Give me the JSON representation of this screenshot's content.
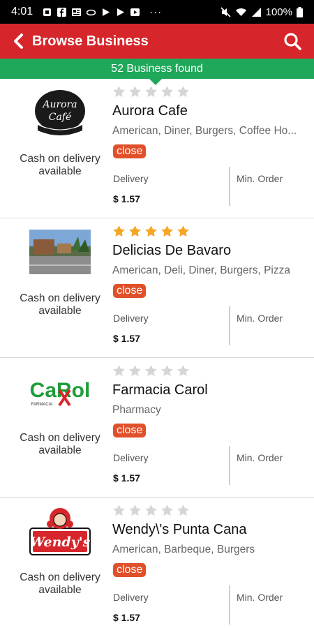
{
  "status_bar": {
    "time": "4:01",
    "more": "···",
    "battery": "100%"
  },
  "header": {
    "title": "Browse Business"
  },
  "found": {
    "text": "52 Business found"
  },
  "colors": {
    "header": "#d7262b",
    "found_bar": "#1fa85a",
    "badge": "#e0502a",
    "star_on": "#f5a623",
    "star_off": "#d6d6d6"
  },
  "logos": {
    "aurora_line1": "Aurora",
    "aurora_line2": "Café",
    "carol_logo": "CaRol",
    "carol_sub": "FARMACIA",
    "wendys_logo": "Wendy's"
  },
  "businesses": [
    {
      "name": "Aurora Cafe",
      "rating": 0,
      "cuisine": "American, Diner, Burgers, Coffee Ho...",
      "status": "close",
      "cod": "Cash on delivery available",
      "delivery_label": "Delivery",
      "delivery_value": "$ 1.57",
      "min_order_label": "Min. Order",
      "logo_icon": "aurora-cafe-logo"
    },
    {
      "name": "Delicias De Bavaro",
      "rating": 5,
      "cuisine": "American, Deli, Diner, Burgers, Pizza",
      "status": "close",
      "cod": "Cash on delivery available",
      "delivery_label": "Delivery",
      "delivery_value": "$ 1.57",
      "min_order_label": "Min. Order",
      "logo_icon": "street-photo"
    },
    {
      "name": "Farmacia Carol",
      "rating": 0,
      "cuisine": "Pharmacy",
      "status": "close",
      "cod": "Cash on delivery available",
      "delivery_label": "Delivery",
      "delivery_value": "$ 1.57",
      "min_order_label": "Min. Order",
      "logo_icon": "farmacia-carol-logo"
    },
    {
      "name": "Wendy\\'s Punta Cana",
      "rating": 0,
      "cuisine": "American, Barbeque, Burgers",
      "status": "close",
      "cod": "Cash on delivery available",
      "delivery_label": "Delivery",
      "delivery_value": "$ 1.57",
      "min_order_label": "Min. Order",
      "logo_icon": "wendys-logo"
    }
  ]
}
